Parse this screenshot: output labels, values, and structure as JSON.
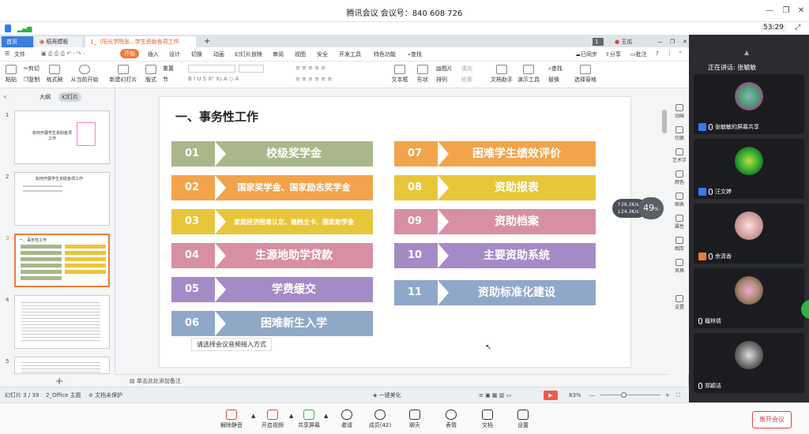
{
  "window": {
    "title": "腾讯会议 会议号：840 608 726",
    "timer": "53:29"
  },
  "colors": {
    "accent": "#f07a3c",
    "green": "#a9b78a",
    "orange": "#f2a44b",
    "yellow": "#e8c63a",
    "pink": "#d78fa3",
    "purple": "#a58bc6",
    "blue": "#8fa8c8",
    "leave": "#e04444"
  },
  "tabs": {
    "home": "首页",
    "template": "稻壳模板",
    "doc": "1_（阳光学院张...学生资助各项工作",
    "new": "+",
    "count": "1",
    "user": "王瓜"
  },
  "menu": {
    "file": "文件",
    "start": "开始",
    "insert": "插入",
    "design": "设计",
    "switch": "切换",
    "animation": "动画",
    "slideshow": "幻灯片放映",
    "review": "审阅",
    "view": "视图",
    "security": "安全",
    "devtools": "开发工具",
    "special": "特色功能",
    "search": "查找",
    "sync": "已同步",
    "share": "分享",
    "comment": "批注"
  },
  "ribbon": {
    "paste": "粘贴",
    "cut": "剪切",
    "copy": "复制",
    "format_painter": "格式刷",
    "play_from_current": "从当前开始",
    "new_slide": "新建幻灯片",
    "layout": "版式",
    "section": "节",
    "reset": "重置",
    "textbox": "文本框",
    "shape": "形状",
    "arrange": "排列",
    "picture": "图片",
    "fill": "填充",
    "outline": "轮廓",
    "doc_helper": "文档助手",
    "presentation_tools": "演示工具",
    "find": "查找",
    "replace": "替换",
    "select_pane": "选择窗格"
  },
  "left_panel": {
    "outline_tab": "大纲",
    "slides_tab": "幻灯片",
    "slide_nums": [
      "1",
      "2",
      "3",
      "4",
      "5"
    ],
    "thumb1_title": "如何开展学生资助各项工作",
    "thumb2_title": "如何开展学生资助各项工作",
    "thumb3_title": "一、事务性工作"
  },
  "slide": {
    "title": "一、事务性工作",
    "items": [
      {
        "num": "01",
        "label": "校级奖学金"
      },
      {
        "num": "02",
        "label": "国家奖学金、国家励志奖学金"
      },
      {
        "num": "03",
        "label": "家庭经济困难认定、建档立卡、国家助学金"
      },
      {
        "num": "04",
        "label": "生源地助学贷款"
      },
      {
        "num": "05",
        "label": "学费缓交"
      },
      {
        "num": "06",
        "label": "困难新生入学"
      },
      {
        "num": "07",
        "label": "困难学生绩效评价"
      },
      {
        "num": "08",
        "label": "资助报表"
      },
      {
        "num": "09",
        "label": "资助档案"
      },
      {
        "num": "10",
        "label": "主要资助系统"
      },
      {
        "num": "11",
        "label": "资助标准化建设"
      }
    ],
    "hint": "请选择会议音频接入方式"
  },
  "widget": {
    "percent": "49",
    "percent_sign": "%",
    "up": "26.2",
    "down": "24.3",
    "unit": "K/s"
  },
  "right_tools": [
    "动画",
    "切换",
    "艺术字",
    "颜色",
    "图表",
    "属性",
    "图库",
    "风格",
    "设置"
  ],
  "notes": "单击此处添加备注",
  "status": {
    "slide_info": "幻灯片 3 / 39",
    "theme": "2_Office 主题",
    "protect": "文档未保护",
    "beautify": "一键美化",
    "zoom": "83%"
  },
  "participants": {
    "speaking": "正在讲话: 张毓敏",
    "list": [
      {
        "name": "张毓敏的屏幕共享"
      },
      {
        "name": "汪文婷"
      },
      {
        "name": "佘清香"
      },
      {
        "name": "檀林倩"
      },
      {
        "name": "郑颖洁"
      }
    ]
  },
  "meeting_bar": {
    "unmute": "解除静音",
    "video": "开启视频",
    "share": "共享屏幕",
    "invite": "邀请",
    "members": "成员(42)",
    "chat": "聊天",
    "reaction": "表情",
    "docs": "文档",
    "settings": "设置",
    "leave": "离开会议"
  }
}
